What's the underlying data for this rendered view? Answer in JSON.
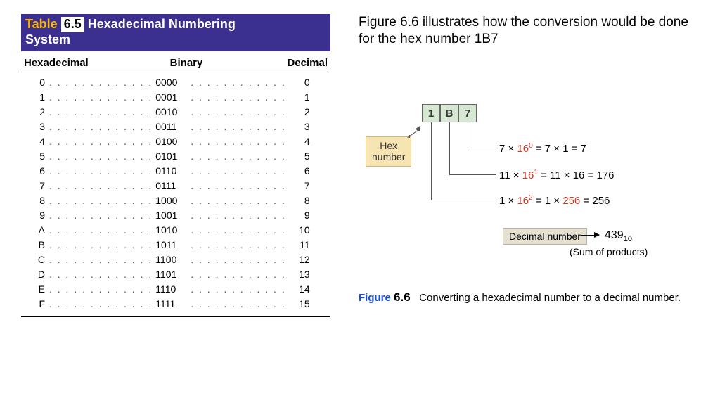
{
  "table": {
    "label": "Table",
    "number": "6.5",
    "title_rest": "Hexadecimal Numbering",
    "title_line2": "System",
    "headers": {
      "h1": "Hexadecimal",
      "h2": "Binary",
      "h3": "Decimal"
    },
    "rows": [
      {
        "hex": "0",
        "bin": "0000",
        "dec": "0"
      },
      {
        "hex": "1",
        "bin": "0001",
        "dec": "1"
      },
      {
        "hex": "2",
        "bin": "0010",
        "dec": "2"
      },
      {
        "hex": "3",
        "bin": "0011",
        "dec": "3"
      },
      {
        "hex": "4",
        "bin": "0100",
        "dec": "4"
      },
      {
        "hex": "5",
        "bin": "0101",
        "dec": "5"
      },
      {
        "hex": "6",
        "bin": "0110",
        "dec": "6"
      },
      {
        "hex": "7",
        "bin": "0111",
        "dec": "7"
      },
      {
        "hex": "8",
        "bin": "1000",
        "dec": "8"
      },
      {
        "hex": "9",
        "bin": "1001",
        "dec": "9"
      },
      {
        "hex": "A",
        "bin": "1010",
        "dec": "10"
      },
      {
        "hex": "B",
        "bin": "1011",
        "dec": "11"
      },
      {
        "hex": "C",
        "bin": "1100",
        "dec": "12"
      },
      {
        "hex": "D",
        "bin": "1101",
        "dec": "13"
      },
      {
        "hex": "E",
        "bin": "1110",
        "dec": "14"
      },
      {
        "hex": "F",
        "bin": "1111",
        "dec": "15"
      }
    ]
  },
  "intro": "Figure 6.6 illustrates how the conversion would be done for the hex number 1B7",
  "diagram": {
    "digits": [
      "1",
      "B",
      "7"
    ],
    "hex_label_l1": "Hex",
    "hex_label_l2": "number",
    "calc1": {
      "lhs": "7 × ",
      "pow_base": "16",
      "pow_exp": "0",
      "mid": " = 7 ×   1  =   ",
      "res": "7"
    },
    "calc2": {
      "lhs": "11 × ",
      "pow_base": "16",
      "pow_exp": "1",
      "mid": " = 11 ×  16  = ",
      "res": "176"
    },
    "calc3": {
      "lhs": "1 × ",
      "pow_base": "16",
      "pow_exp": "2",
      "mid": " = 1 × ",
      "mul": "256",
      "eq": " = ",
      "res": "256"
    },
    "dec_label": "Decimal number",
    "dec_result": "439",
    "dec_sub": "10",
    "sum_note": "(Sum of products)"
  },
  "fig": {
    "label": "Figure",
    "number": "6.6",
    "caption": "Converting a hexadecimal number to a decimal number."
  }
}
